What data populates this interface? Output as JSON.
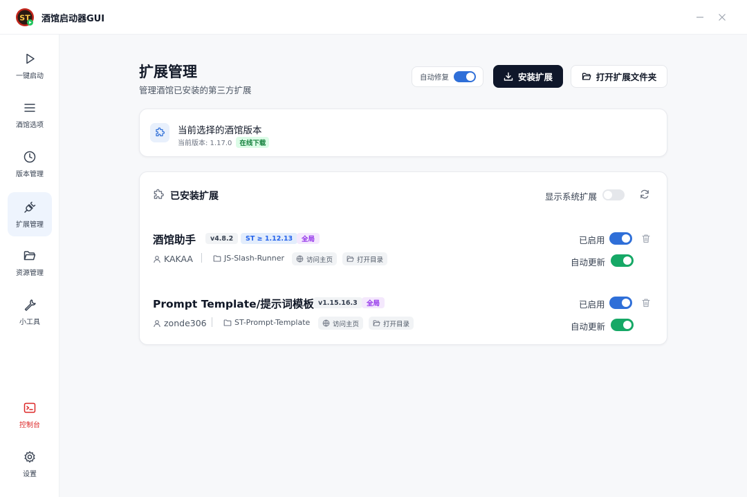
{
  "app": {
    "title": "酒馆启动器GUI",
    "logo_text": "ST"
  },
  "sidebar": {
    "items": [
      {
        "label": "一键启动",
        "icon": "play-icon"
      },
      {
        "label": "酒馆选项",
        "icon": "menu-icon"
      },
      {
        "label": "版本管理",
        "icon": "clock-icon"
      },
      {
        "label": "扩展管理",
        "icon": "plug-icon",
        "active": true
      },
      {
        "label": "资源管理",
        "icon": "folder-icon"
      },
      {
        "label": "小工具",
        "icon": "wrench-icon"
      }
    ],
    "bottom": [
      {
        "label": "控制台",
        "icon": "terminal-icon",
        "color": "#dc2626"
      },
      {
        "label": "设置",
        "icon": "gear-icon"
      }
    ]
  },
  "header": {
    "title": "扩展管理",
    "subtitle": "管理酒馆已安装的第三方扩展",
    "autofix_label": "自动修复",
    "autofix_on": true,
    "install_label": "安装扩展",
    "open_folder_label": "打开扩展文件夹"
  },
  "version_card": {
    "title": "当前选择的酒馆版本",
    "current": "当前版本: 1.17.0",
    "badge": "在线下载"
  },
  "extensions": {
    "title": "已安装扩展",
    "show_system_label": "显示系统扩展",
    "show_system_on": false,
    "items": [
      {
        "name": "酒馆助手",
        "version": "v4.8.2",
        "st_req": "ST ≥ 1.12.13",
        "scope": "全局",
        "author": "KAKAA",
        "folder": "JS-Slash-Runner",
        "visit_label": "访问主页",
        "open_dir_label": "打开目录",
        "enabled_label": "已启用",
        "enabled": true,
        "auto_update_label": "自动更新",
        "auto_update": true
      },
      {
        "name": "Prompt Template/提示词模板",
        "version": "v1.15.16.3",
        "st_req": "",
        "scope": "全局",
        "author": "zonde306",
        "folder": "ST-Prompt-Template",
        "visit_label": "访问主页",
        "open_dir_label": "打开目录",
        "enabled_label": "已启用",
        "enabled": true,
        "auto_update_label": "自动更新",
        "auto_update": true
      }
    ]
  },
  "colors": {
    "accent": "#2f6fd8",
    "success": "#16a866",
    "dark_button": "#0f172a",
    "danger": "#dc2626"
  }
}
